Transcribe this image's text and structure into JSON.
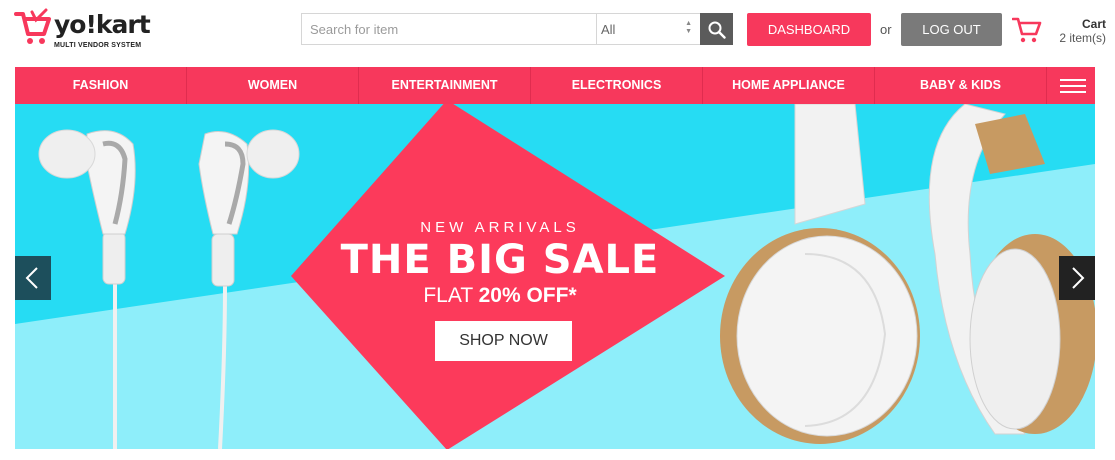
{
  "brand": {
    "name": "yo!kart",
    "tagline": "MULTI VENDOR SYSTEM",
    "accent": "#f7385c"
  },
  "search": {
    "placeholder": "Search for item",
    "category": "All",
    "icon": "search-icon"
  },
  "header": {
    "dashboard_label": "DASHBOARD",
    "or_text": "or",
    "logout_label": "LOG OUT"
  },
  "cart": {
    "label": "Cart",
    "count_text": "2 item(s)",
    "icon": "cart-icon"
  },
  "nav": {
    "items": [
      {
        "label": "FASHION"
      },
      {
        "label": "WOMEN"
      },
      {
        "label": "ENTERTAINMENT"
      },
      {
        "label": "ELECTRONICS"
      },
      {
        "label": "HOME APPLIANCE"
      },
      {
        "label": "BABY & KIDS"
      }
    ],
    "menu_icon": "hamburger-icon"
  },
  "banner": {
    "kicker": "NEW ARRIVALS",
    "headline": "THE BIG SALE",
    "offer_prefix": "FLAT",
    "offer_value": "20% OFF*",
    "cta_label": "SHOP NOW",
    "prev_icon": "chevron-left-icon",
    "next_icon": "chevron-right-icon"
  }
}
